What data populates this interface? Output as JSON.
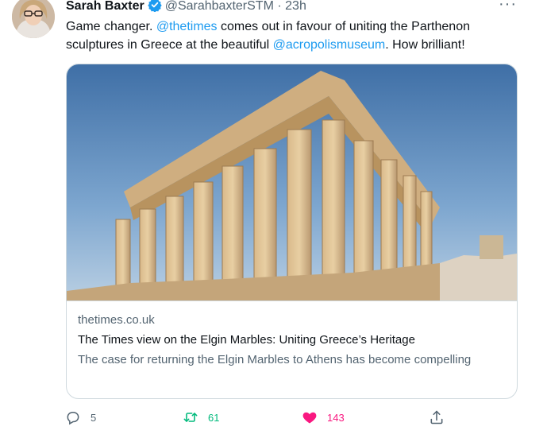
{
  "tweet": {
    "author_name": "Sarah Baxter",
    "handle": "@SarahbaxterSTM",
    "separator": "·",
    "time": "23h",
    "more_label": "···",
    "text": {
      "part1": "Game changer. ",
      "mention1": "@thetimes",
      "part2": " comes out in favour of uniting the Parthenon sculptures in Greece at the beautiful ",
      "mention2": "@acropolismuseum",
      "part3": ". How brilliant!"
    }
  },
  "card": {
    "domain": "thetimes.co.uk",
    "title": "The Times view on the Elgin Marbles: Uniting Greece’s Heritage",
    "description": "The case for returning the Elgin Marbles to Athens has become compelling"
  },
  "actions": {
    "reply_count": "5",
    "retweet_count": "61",
    "like_count": "143"
  },
  "colors": {
    "accent": "#1d9bf0",
    "retweet": "#00ba7c",
    "like": "#f91880",
    "muted": "#536471"
  },
  "icons": [
    "verified-badge-icon",
    "more-icon",
    "reply-icon",
    "retweet-icon",
    "heart-icon",
    "share-icon"
  ]
}
